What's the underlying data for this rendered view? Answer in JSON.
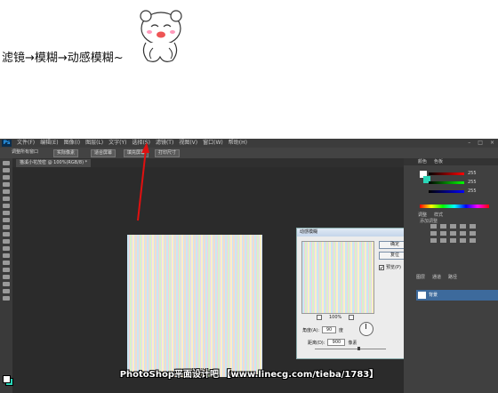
{
  "caption": "滤镜→模糊→动感模糊~",
  "photoshop": {
    "menu": [
      "文件(F)",
      "编辑(E)",
      "图像(I)",
      "图层(L)",
      "文字(Y)",
      "选择(S)",
      "滤镜(T)",
      "视图(V)",
      "窗口(W)",
      "帮助(H)"
    ],
    "logo": "Ps",
    "options": [
      "调整所有窗口",
      "实际像素",
      "适合屏幕",
      "填充屏幕",
      "打印尺寸"
    ],
    "doc_tab": "猫溪小花茂密 @ 100%(RGB/8) *",
    "right_tabs": [
      "颜色",
      "色板"
    ],
    "styles_tabs": [
      "调整",
      "样式"
    ],
    "adj_label": "添加调整",
    "layer_tabs": [
      "图层",
      "通道",
      "路径"
    ],
    "layer_name": "背景",
    "color_values": {
      "r": "255",
      "g": "255",
      "b": "255"
    },
    "colors": {
      "accent": "#2ad6b8",
      "layer": "#3d6a9c"
    }
  },
  "dialog": {
    "title": "动感模糊",
    "ok": "确定",
    "reset": "复位",
    "preview_label": "预览(P)",
    "preview_checked": true,
    "zoom": "100%",
    "angle_label": "角度(A):",
    "angle_value": "90",
    "angle_unit": "度",
    "distance_label": "距离(D):",
    "distance_value": "900",
    "distance_unit": "像素"
  },
  "watermark": "PhotoShop平面设计吧 【www.linecg.com/tieba/1783】"
}
